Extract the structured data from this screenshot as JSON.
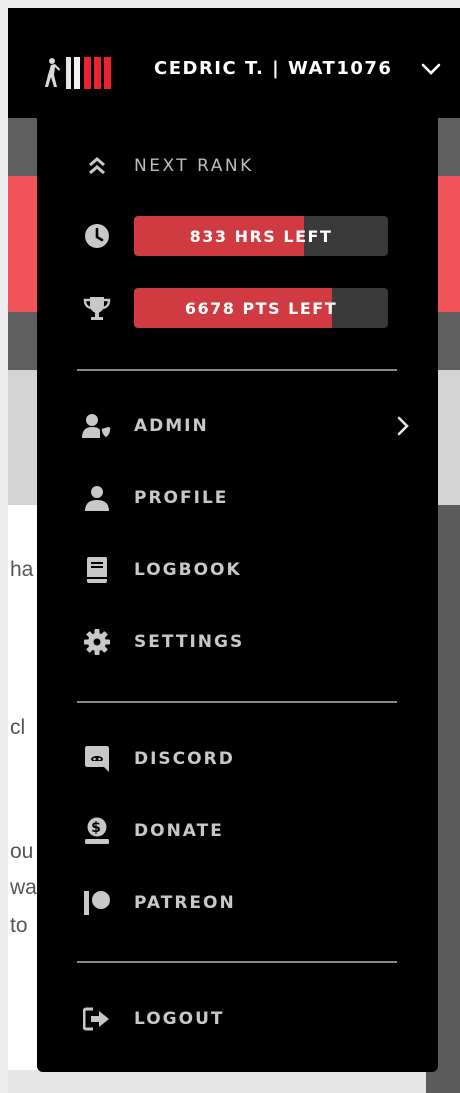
{
  "header": {
    "user_label": "CEDRIC T. | WAT1076"
  },
  "background_peek": [
    "ha",
    "cl",
    "ou",
    "wa",
    "to"
  ],
  "menu": {
    "next_rank_label": "NEXT RANK",
    "hours_left": {
      "label": "833 HRS LEFT",
      "progress_percent": 67
    },
    "points_left": {
      "label": "6678 PTS LEFT",
      "progress_percent": 78
    },
    "items": [
      {
        "label": "ADMIN",
        "icon": "user-shield-icon"
      },
      {
        "label": "PROFILE",
        "icon": "user-icon"
      },
      {
        "label": "LOGBOOK",
        "icon": "book-icon"
      },
      {
        "label": "SETTINGS",
        "icon": "gear-icon"
      },
      {
        "label": "DISCORD",
        "icon": "discord-icon"
      },
      {
        "label": "DONATE",
        "icon": "donate-icon"
      },
      {
        "label": "PATREON",
        "icon": "patreon-icon"
      },
      {
        "label": "LOGOUT",
        "icon": "logout-icon"
      }
    ]
  },
  "colors": {
    "progress_fill": "#d03b41",
    "progress_track": "#3a3a3a",
    "menu_bg": "#000000",
    "accent_red": "#f2545b"
  }
}
